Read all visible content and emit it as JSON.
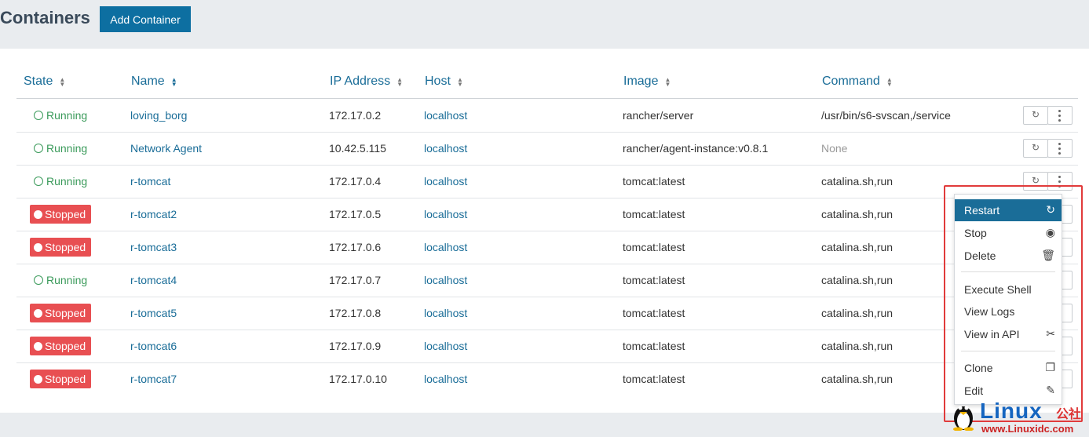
{
  "header": {
    "title": "Containers",
    "add_button": "Add Container"
  },
  "table": {
    "columns": [
      "State",
      "Name",
      "IP Address",
      "Host",
      "Image",
      "Command"
    ],
    "rows": [
      {
        "state": "Running",
        "name": "loving_borg",
        "ip": "172.17.0.2",
        "host": "localhost",
        "image": "rancher/server",
        "command": "/usr/bin/s6-svscan,/service"
      },
      {
        "state": "Running",
        "name": "Network Agent",
        "ip": "10.42.5.115",
        "host": "localhost",
        "image": "rancher/agent-instance:v0.8.1",
        "command": "None"
      },
      {
        "state": "Running",
        "name": "r-tomcat",
        "ip": "172.17.0.4",
        "host": "localhost",
        "image": "tomcat:latest",
        "command": "catalina.sh,run"
      },
      {
        "state": "Stopped",
        "name": "r-tomcat2",
        "ip": "172.17.0.5",
        "host": "localhost",
        "image": "tomcat:latest",
        "command": "catalina.sh,run"
      },
      {
        "state": "Stopped",
        "name": "r-tomcat3",
        "ip": "172.17.0.6",
        "host": "localhost",
        "image": "tomcat:latest",
        "command": "catalina.sh,run"
      },
      {
        "state": "Running",
        "name": "r-tomcat4",
        "ip": "172.17.0.7",
        "host": "localhost",
        "image": "tomcat:latest",
        "command": "catalina.sh,run"
      },
      {
        "state": "Stopped",
        "name": "r-tomcat5",
        "ip": "172.17.0.8",
        "host": "localhost",
        "image": "tomcat:latest",
        "command": "catalina.sh,run"
      },
      {
        "state": "Stopped",
        "name": "r-tomcat6",
        "ip": "172.17.0.9",
        "host": "localhost",
        "image": "tomcat:latest",
        "command": "catalina.sh,run"
      },
      {
        "state": "Stopped",
        "name": "r-tomcat7",
        "ip": "172.17.0.10",
        "host": "localhost",
        "image": "tomcat:latest",
        "command": "catalina.sh,run"
      }
    ]
  },
  "menu": {
    "items": [
      {
        "label": "Restart",
        "icon": "restart-icon"
      },
      {
        "label": "Stop",
        "icon": "stop-icon"
      },
      {
        "label": "Delete",
        "icon": "trash-icon"
      },
      {
        "label": "Execute Shell",
        "icon": ""
      },
      {
        "label": "View Logs",
        "icon": ""
      },
      {
        "label": "View in API",
        "icon": "api-icon"
      },
      {
        "label": "Clone",
        "icon": "clone-icon"
      },
      {
        "label": "Edit",
        "icon": "pencil-icon"
      }
    ]
  },
  "watermark": {
    "brand": "Linux",
    "cn": "公社",
    "url": "www.Linuxidc.com"
  },
  "colors": {
    "accent": "#1a6d98",
    "button": "#0d6fa1",
    "running": "#3a9a5a",
    "stopped": "#e84f52",
    "highlight_box": "#e13b3b"
  }
}
